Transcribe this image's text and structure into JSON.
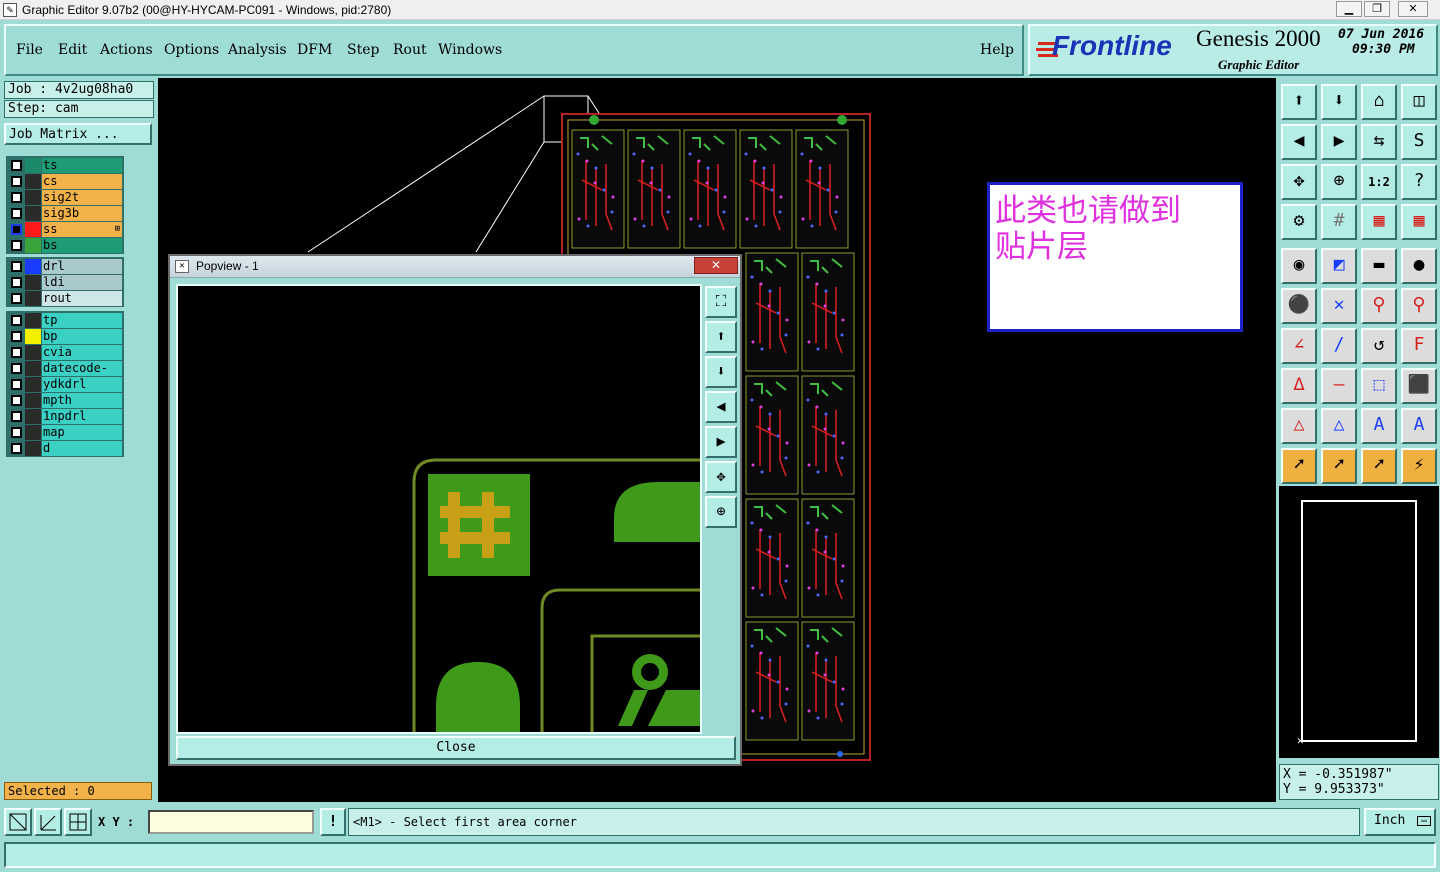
{
  "titlebar": {
    "title": "Graphic Editor 9.07b2 (00@HY-HYCAM-PC091 - Windows, pid:2780)",
    "minimize_icon": "minimize-icon",
    "restore_icon": "restore-icon",
    "close_icon": "close-icon"
  },
  "menu": {
    "items": [
      "File",
      "Edit",
      "Actions",
      "Options",
      "Analysis",
      "DFM",
      "Step",
      "Rout",
      "Windows"
    ],
    "help": "Help"
  },
  "brand": {
    "logo": "Frontline",
    "product": "Genesis 2000",
    "subtitle": "Graphic Editor",
    "date": "07 Jun 2016",
    "time": "09:30 PM"
  },
  "job": {
    "job_label": "Job : 4v2ug08ha0",
    "step_label": "Step: cam",
    "matrix_button": "Job Matrix ..."
  },
  "layers": {
    "group1": [
      {
        "name": "ts",
        "color": "#1a8a6a",
        "bg": "#1e9c78"
      },
      {
        "name": "cs",
        "color": "#2b2b2b",
        "bg": "#f2b24a"
      },
      {
        "name": "sig2t",
        "color": "#2b2b2b",
        "bg": "#f2b24a"
      },
      {
        "name": "sig3b",
        "color": "#2b2b2b",
        "bg": "#f2b24a"
      },
      {
        "name": "ss",
        "color": "#ff1a1a",
        "bg": "#f2b24a",
        "selected": true,
        "marker": "⊞"
      },
      {
        "name": "bs",
        "color": "#3aa33a",
        "bg": "#1e9c78"
      }
    ],
    "group2": [
      {
        "name": "drl",
        "color": "#1a3cff",
        "bg": "#a9c9cc"
      },
      {
        "name": "ldi",
        "color": "#2b2b2b",
        "bg": "#a9c9cc"
      },
      {
        "name": "rout",
        "color": "#2b2b2b",
        "bg": "#cfe6e8"
      }
    ],
    "group3": [
      {
        "name": "tp",
        "color": "#2b2b2b",
        "bg": "#3ad0c4"
      },
      {
        "name": "bp",
        "color": "#f4f000",
        "bg": "#3ad0c4"
      },
      {
        "name": "cvia",
        "color": "#2b2b2b",
        "bg": "#3ad0c4"
      },
      {
        "name": "datecode-bs",
        "color": "#2b2b2b",
        "bg": "#3ad0c4"
      },
      {
        "name": "ydkdrl",
        "color": "#2b2b2b",
        "bg": "#3ad0c4"
      },
      {
        "name": "mpth",
        "color": "#2b2b2b",
        "bg": "#3ad0c4"
      },
      {
        "name": "1npdrl",
        "color": "#2b2b2b",
        "bg": "#3ad0c4"
      },
      {
        "name": "map",
        "color": "#2b2b2b",
        "bg": "#3ad0c4"
      },
      {
        "name": "d",
        "color": "#2b2b2b",
        "bg": "#3ad0c4"
      }
    ]
  },
  "selected": "Selected : 0",
  "note": {
    "line1": "此类也请做到",
    "line2": "贴片层"
  },
  "popview": {
    "title": "Popview - 1",
    "close": "Close",
    "tool_icons": [
      "zoom-fit-icon",
      "pan-up-icon",
      "pan-down-icon",
      "pan-left-icon",
      "pan-right-icon",
      "zoom-in-icon",
      "zoom-out-icon"
    ]
  },
  "toolbar": {
    "icons": [
      "view-top-icon",
      "view-bottom-icon",
      "home-icon",
      "split-window-icon",
      "view-left-icon",
      "view-right-icon",
      "mirror-icon",
      "rotate-s-icon",
      "fit-icon",
      "zoom-fit-icon",
      "scale-1-2-icon",
      "help-icon",
      "snap-icon",
      "grid-icon",
      "layer-stack-icon",
      "layer-stack-red-icon",
      "select-pad-icon",
      "select-region-icon",
      "ruler-icon",
      "circle-icon",
      "net-icon",
      "delete-icon",
      "connect-icon",
      "connect-red-icon",
      "draw-line-icon",
      "draw-arc-icon",
      "undo-arc-icon",
      "text-icon",
      "measure-icon",
      "line-break-icon",
      "dimension-icon",
      "shapes-icon",
      "triangle-red-icon",
      "triangle-blue-icon",
      "triangle-up-icon",
      "triangle-arrow-icon",
      "pointer-icon",
      "pointer-box-icon",
      "pointer-circle-icon",
      "route-icon"
    ],
    "scale_label": "1:2"
  },
  "coords": {
    "x": "X = -0.351987\"",
    "y": "Y = 9.953373\""
  },
  "command": {
    "xy_label": "X Y :",
    "xy_value": "",
    "warning": "!",
    "prompt": "<M1> - Select first area corner",
    "units": "Inch"
  }
}
